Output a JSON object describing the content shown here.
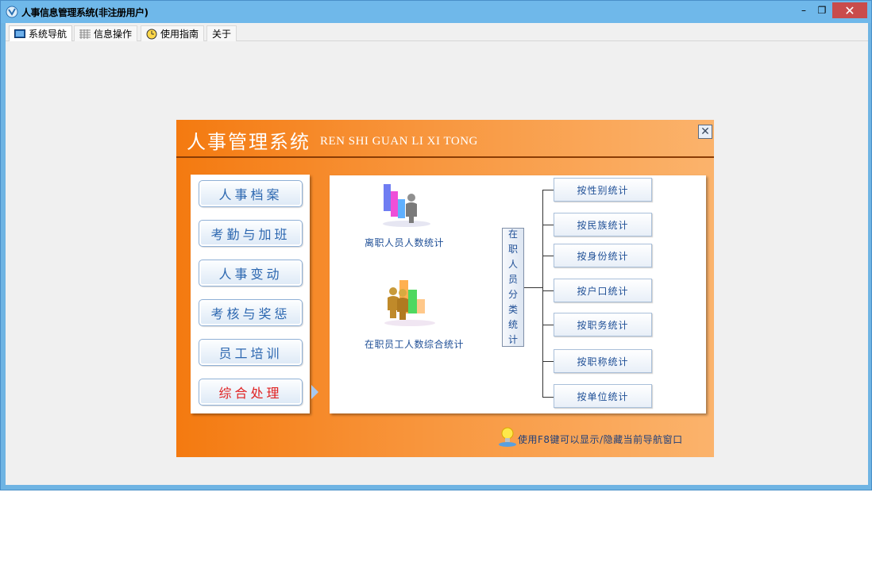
{
  "window": {
    "title": "人事信息管理系统(非注册用户)",
    "minimize_label": "–",
    "maximize_label": "❐",
    "close_label": "✕"
  },
  "tabs": [
    {
      "label": "系统导航",
      "icon": "monitor-icon"
    },
    {
      "label": "信息操作",
      "icon": "grid-icon"
    },
    {
      "label": "使用指南",
      "icon": "clock-icon"
    },
    {
      "label": "关于",
      "icon": ""
    }
  ],
  "panel": {
    "title": "人事管理系统",
    "subtitle": "REN SHI GUAN LI XI TONG",
    "close_label": "✕"
  },
  "menu": [
    {
      "label": "人事档案",
      "active": false
    },
    {
      "label": "考勤与加班",
      "active": false
    },
    {
      "label": "人事变动",
      "active": false
    },
    {
      "label": "考核与奖惩",
      "active": false
    },
    {
      "label": "员工培训",
      "active": false
    },
    {
      "label": "综合处理",
      "active": true
    }
  ],
  "content": {
    "left_items": [
      {
        "label": "离职人员人数统计",
        "icon": "bar-chart-person-icon"
      },
      {
        "label": "在职员工人数综合统计",
        "icon": "bar-chart-group-icon"
      }
    ],
    "vertical_label": [
      "在",
      "职",
      "人",
      "员",
      "分",
      "类",
      "统",
      "计"
    ],
    "stat_buttons": [
      "按性别统计",
      "按民族统计",
      "按身份统计",
      "按户口统计",
      "按职务统计",
      "按职称统计",
      "按单位统计"
    ]
  },
  "hint": "使用F8键可以显示/隐藏当前导航窗口",
  "colors": {
    "titlebar": "#6fb8ea",
    "panel_orange": "#f47a10",
    "menu_text": "#2c67b0",
    "menu_active_text": "#e02020",
    "close_red": "#c94c4c"
  }
}
